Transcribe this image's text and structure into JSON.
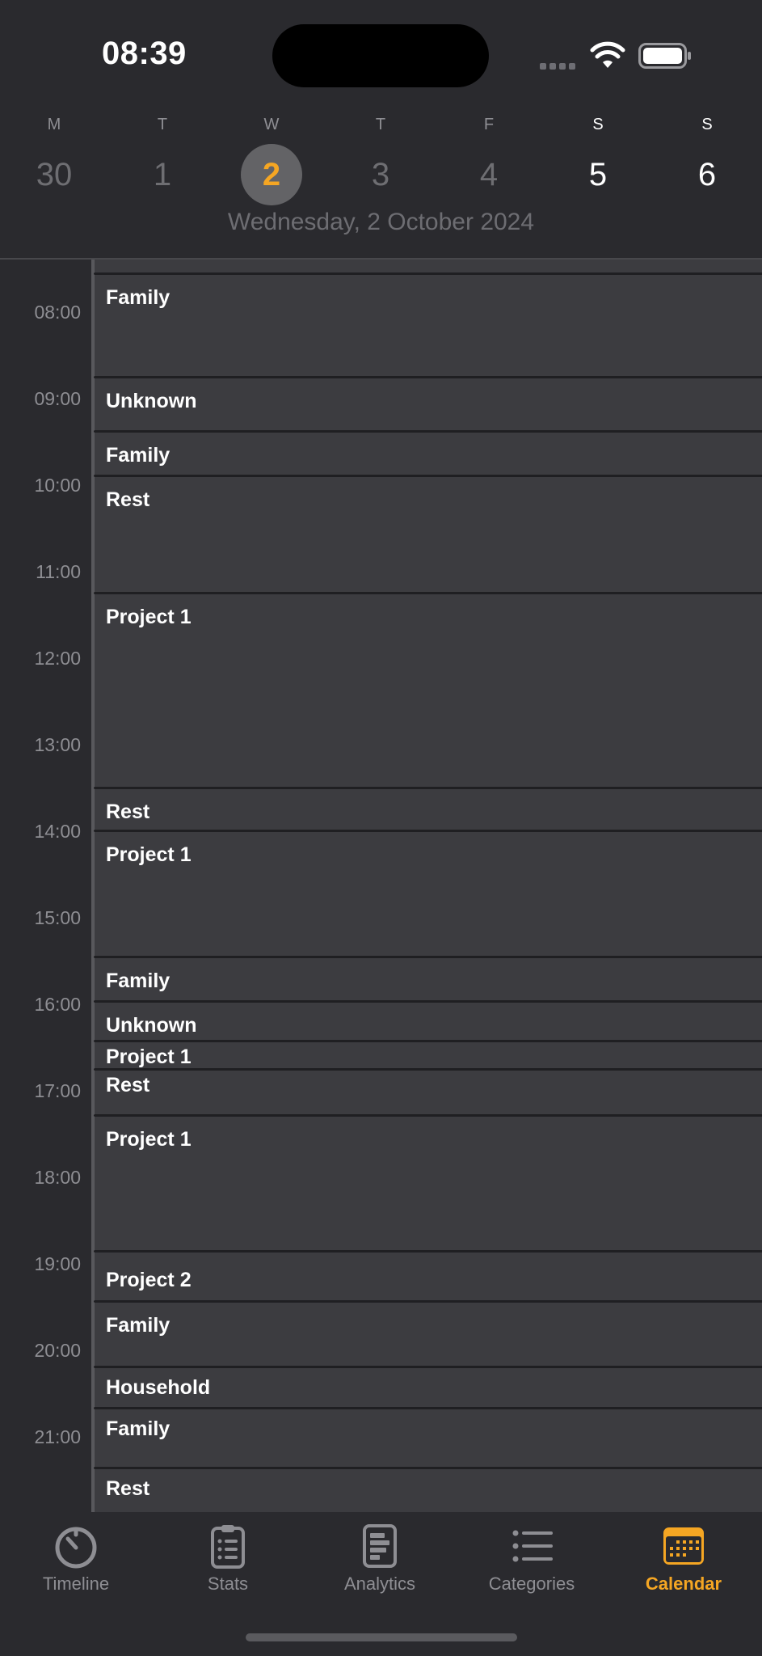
{
  "status": {
    "time": "08:39"
  },
  "week": {
    "days": [
      {
        "letter": "M",
        "number": "30"
      },
      {
        "letter": "T",
        "number": "1"
      },
      {
        "letter": "W",
        "number": "2"
      },
      {
        "letter": "T",
        "number": "3"
      },
      {
        "letter": "F",
        "number": "4"
      },
      {
        "letter": "S",
        "number": "5"
      },
      {
        "letter": "S",
        "number": "6"
      }
    ],
    "selected_index": 2,
    "date_label": "Wednesday, 2 October 2024"
  },
  "timeline": {
    "hours": [
      "08:00",
      "09:00",
      "10:00",
      "11:00",
      "12:00",
      "13:00",
      "14:00",
      "15:00",
      "16:00",
      "17:00",
      "18:00",
      "19:00",
      "20:00",
      "21:00"
    ],
    "events": [
      {
        "title": "Family"
      },
      {
        "title": "Unknown"
      },
      {
        "title": "Family"
      },
      {
        "title": "Rest"
      },
      {
        "title": "Project 1"
      },
      {
        "title": "Rest"
      },
      {
        "title": "Project 1"
      },
      {
        "title": "Family"
      },
      {
        "title": "Unknown"
      },
      {
        "title": "Project 1"
      },
      {
        "title": "Rest"
      },
      {
        "title": "Project 1"
      },
      {
        "title": "Project 2"
      },
      {
        "title": "Family"
      },
      {
        "title": "Household"
      },
      {
        "title": "Family"
      },
      {
        "title": "Rest"
      }
    ]
  },
  "tabs": [
    {
      "label": "Timeline",
      "icon": "timer-icon"
    },
    {
      "label": "Stats",
      "icon": "clipboard-list-icon"
    },
    {
      "label": "Analytics",
      "icon": "bar-chart-document-icon"
    },
    {
      "label": "Categories",
      "icon": "list-bullet-icon"
    },
    {
      "label": "Calendar",
      "icon": "calendar-icon",
      "active": true
    }
  ],
  "colors": {
    "accent": "#f5a623",
    "background": "#2a2a2e",
    "event_fill": "#3c3c40"
  }
}
